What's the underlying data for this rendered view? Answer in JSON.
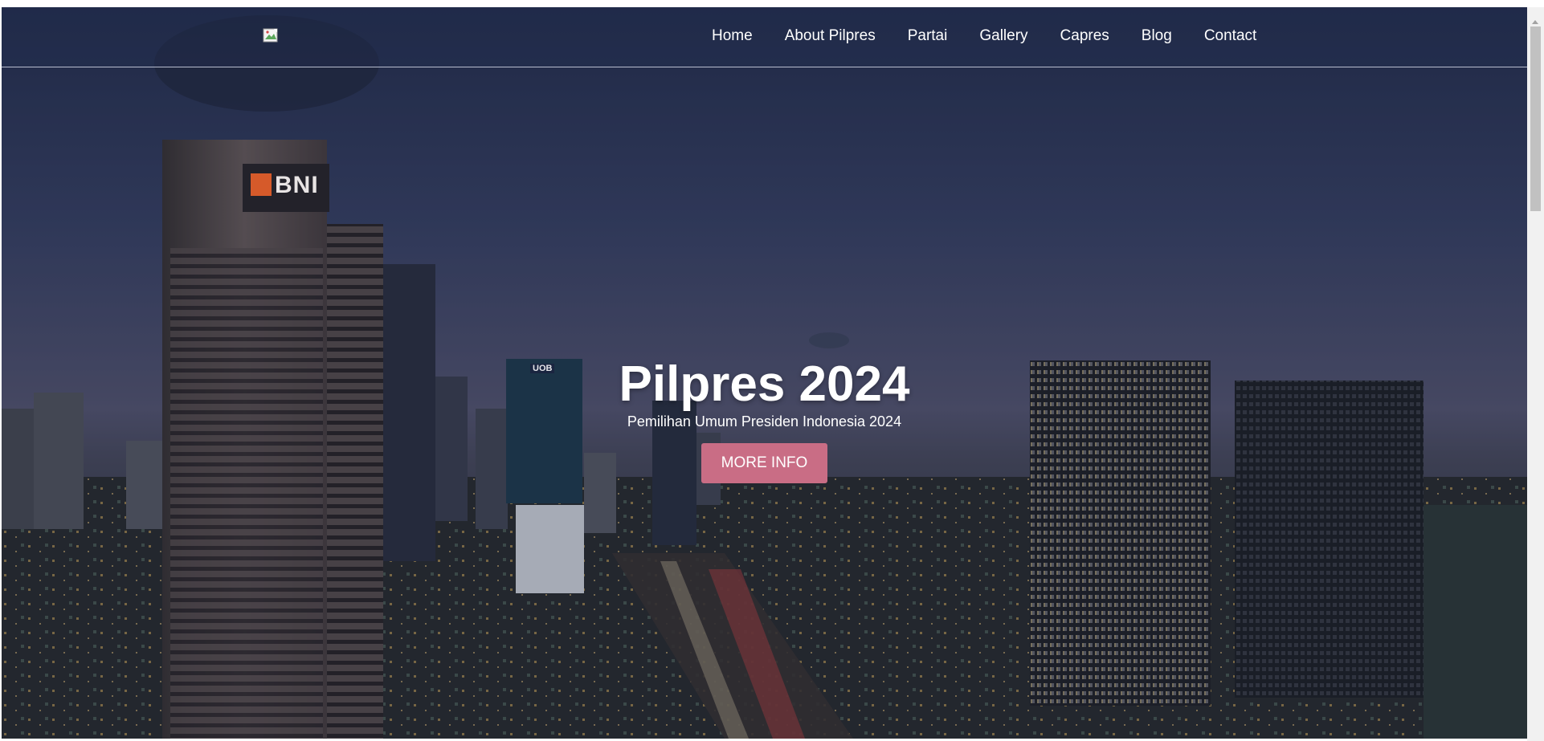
{
  "header": {
    "logo_alt": "",
    "nav": [
      {
        "label": "Home"
      },
      {
        "label": "About Pilpres"
      },
      {
        "label": "Partai"
      },
      {
        "label": "Gallery"
      },
      {
        "label": "Capres"
      },
      {
        "label": "Blog"
      },
      {
        "label": "Contact"
      }
    ]
  },
  "hero": {
    "title": "Pilpres 2024",
    "subtitle": "Pemilihan Umum Presiden Indonesia 2024",
    "button_label": "MORE INFO",
    "background_image": "city-skyline-night",
    "building_sign_text": "BNI",
    "small_sign_text": "UOB"
  },
  "colors": {
    "button": "#c96d85",
    "nav_text": "#ffffff",
    "sky": "#3b4466"
  }
}
